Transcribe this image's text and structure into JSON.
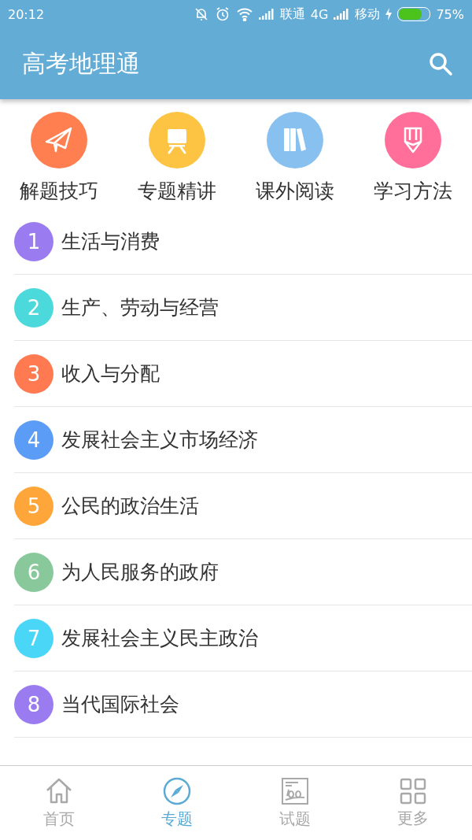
{
  "status_bar": {
    "time": "20:12",
    "carrier_1": "联通",
    "network": "4G",
    "carrier_2": "移动",
    "battery": "75%"
  },
  "app_bar": {
    "title": "高考地理通"
  },
  "shortcuts": [
    {
      "label": "解题技巧",
      "kind": "plane",
      "color": "#ff7f50"
    },
    {
      "label": "专题精讲",
      "kind": "board",
      "color": "#fdc444"
    },
    {
      "label": "课外阅读",
      "kind": "books",
      "color": "#88c0f0"
    },
    {
      "label": "学习方法",
      "kind": "pencil",
      "color": "#ff6f9a"
    }
  ],
  "topics": [
    {
      "number": "1",
      "title": "生活与消费",
      "color": "#9b7cf0"
    },
    {
      "number": "2",
      "title": "生产、劳动与经营",
      "color": "#4cd9dc"
    },
    {
      "number": "3",
      "title": "收入与分配",
      "color": "#ff7a50"
    },
    {
      "number": "4",
      "title": "发展社会主义市场经济",
      "color": "#5b9cf6"
    },
    {
      "number": "5",
      "title": "公民的政治生活",
      "color": "#ffa63a"
    },
    {
      "number": "6",
      "title": "为人民服务的政府",
      "color": "#88c89a"
    },
    {
      "number": "7",
      "title": "发展社会主义民主政治",
      "color": "#4ad6f7"
    },
    {
      "number": "8",
      "title": "当代国际社会",
      "color": "#9b7cf0"
    }
  ],
  "bottom_nav": [
    {
      "label": "首页",
      "kind": "home",
      "selected": false
    },
    {
      "label": "专题",
      "kind": "compass",
      "selected": true
    },
    {
      "label": "试题",
      "kind": "exam",
      "selected": false
    },
    {
      "label": "更多",
      "kind": "grid",
      "selected": false
    }
  ]
}
